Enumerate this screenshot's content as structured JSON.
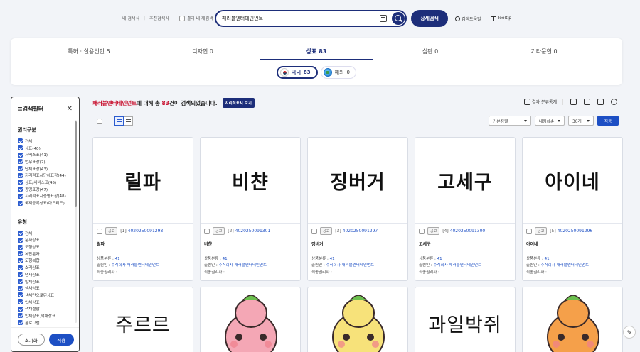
{
  "quick_links": {
    "my_search": "내 검색식",
    "recommend": "추천검색식",
    "within_results": "결과 내 재검색"
  },
  "search": {
    "value": "패러블엔터테인먼트"
  },
  "advanced_button": "상세검색",
  "help": {
    "search_help": "검색도움말",
    "tooltip": "Tooltip"
  },
  "categories": [
    {
      "label": "특허 · 실용신안",
      "count": "5"
    },
    {
      "label": "디자인",
      "count": "0"
    },
    {
      "label": "상표",
      "count": "83"
    },
    {
      "label": "심판",
      "count": "0"
    },
    {
      "label": "기타문헌",
      "count": "0"
    }
  ],
  "subtabs": [
    {
      "label": "국내",
      "count": "83"
    },
    {
      "label": "해외",
      "count": "0"
    }
  ],
  "filter": {
    "title": "검색필터",
    "rights_title": "권리구분",
    "rights": [
      "전체",
      "상표(40)",
      "서비스표(41)",
      "업무표장(2)",
      "단체표장(43)",
      "지리적표시단체표장(44)",
      "상표/서비스표(45)",
      "증명표장(47)",
      "지리적표시증명표장(48)",
      "국제등록상표(마드리드)"
    ],
    "type_title": "유형",
    "types": [
      "전체",
      "문자상표",
      "도형상표",
      "복합문자",
      "도형복합",
      "소리상표",
      "냄새상표",
      "입체상표",
      "색채상표",
      "색채만으로된상표",
      "입체상표",
      "색채결합",
      "입체상표,색채상표",
      "홀로그램"
    ],
    "reset": "초기화",
    "apply": "적용"
  },
  "results": {
    "keyword": "패러블엔터테인먼트",
    "mid": "에 대해 총 ",
    "count": "83",
    "tail": "건이 검색되었습니다.",
    "label_button": "지리적표시 보기"
  },
  "toolbar": {
    "stats": "결과 분류통계"
  },
  "controls": {
    "sort": "기본정렬",
    "order": "내림차순",
    "per_page": "30개",
    "apply": "적용"
  },
  "cards": [
    {
      "image_text": "릴파",
      "badge": "공고",
      "idx": "[1]",
      "app_no": "4020250091298",
      "name": "릴파",
      "class_label": "상품분류 : ",
      "class_val": "41",
      "applicant_label": "출원인 : ",
      "applicant": "주식회사 패러블엔터테인먼트",
      "holder_label": "최종권리자 : "
    },
    {
      "image_text": "비챤",
      "badge": "공고",
      "idx": "[2]",
      "app_no": "4020250091301",
      "name": "비챤",
      "class_label": "상품분류 : ",
      "class_val": "41",
      "applicant_label": "출원인 : ",
      "applicant": "주식회사 패러블엔터테인먼트",
      "holder_label": "최종권리자 : "
    },
    {
      "image_text": "징버거",
      "badge": "공고",
      "idx": "[3]",
      "app_no": "4020250091297",
      "name": "징버거",
      "class_label": "상품분류 : ",
      "class_val": "41",
      "applicant_label": "출원인 : ",
      "applicant": "주식회사 패러블엔터테인먼트",
      "holder_label": "최종권리자 : "
    },
    {
      "image_text": "고세구",
      "badge": "공고",
      "idx": "[4]",
      "app_no": "4020250091300",
      "name": "고세구",
      "class_label": "상품분류 : ",
      "class_val": "41",
      "applicant_label": "출원인 : ",
      "applicant": "주식회사 패러블엔터테인먼트",
      "holder_label": "최종권리자 : "
    },
    {
      "image_text": "아이네",
      "badge": "공고",
      "idx": "[5]",
      "app_no": "4020250091296",
      "name": "아이네",
      "class_label": "상품분류 : ",
      "class_val": "41",
      "applicant_label": "출원인 : ",
      "applicant": "주식회사 패러블엔터테인먼트",
      "holder_label": "최종권리자 : "
    }
  ],
  "cards_row2": [
    {
      "image_text": "주르르"
    },
    {
      "image_text": ""
    },
    {
      "image_text": ""
    },
    {
      "image_text": "과일박쥐"
    },
    {
      "image_text": ""
    }
  ],
  "colors": {
    "navy": "#1d2e7a",
    "blue": "#1d4fc4",
    "red": "#c8102e"
  }
}
